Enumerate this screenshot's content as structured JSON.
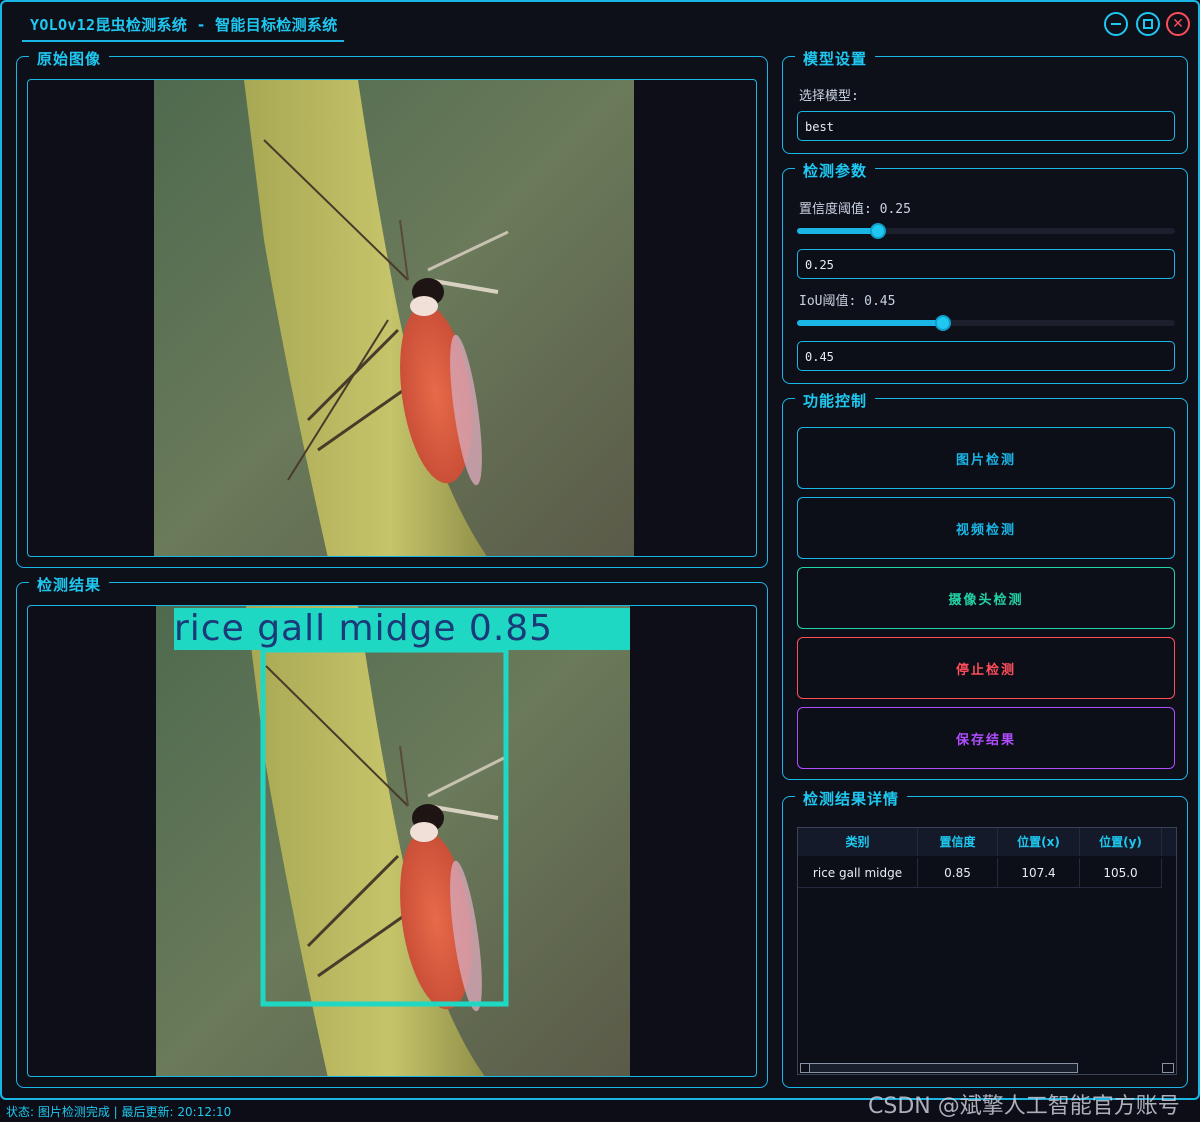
{
  "window": {
    "title": "YOLOv12昆虫检测系统 - 智能目标检测系统"
  },
  "panels": {
    "original": {
      "title": "原始图像"
    },
    "result": {
      "title": "检测结果",
      "detection_label": "rice gall midge 0.85"
    },
    "model": {
      "title": "模型设置",
      "select_label": "选择模型:",
      "model_value": "best"
    },
    "params": {
      "title": "检测参数",
      "conf_label": "置信度阈值: 0.25",
      "conf_value": "0.25",
      "conf_level": 0.25,
      "iou_label": "IoU阈值: 0.45",
      "iou_value": "0.45",
      "iou_level": 0.45
    },
    "controls": {
      "title": "功能控制",
      "buttons": [
        {
          "label": "图片检测",
          "color": "#1ab6e6"
        },
        {
          "label": "视频检测",
          "color": "#1ab6e6"
        },
        {
          "label": "摄像头检测",
          "color": "#22d3a6"
        },
        {
          "label": "停止检测",
          "color": "#ff4d5a"
        },
        {
          "label": "保存结果",
          "color": "#b14dff"
        }
      ]
    },
    "details": {
      "title": "检测结果详情",
      "columns": [
        "类别",
        "置信度",
        "位置(x)",
        "位置(y)"
      ],
      "rows": [
        [
          "rice gall midge",
          "0.85",
          "107.4",
          "105.0"
        ]
      ]
    }
  },
  "statusbar": {
    "text": "状态: 图片检测完成 | 最后更新: 20:12:10"
  },
  "watermark": "CSDN @斌擎人工智能官方账号",
  "colors": {
    "accent": "#1ab6e6",
    "detection_box": "#1fd8c4",
    "stop": "#ff4d5a",
    "save": "#b14dff",
    "camera": "#22d3a6"
  }
}
